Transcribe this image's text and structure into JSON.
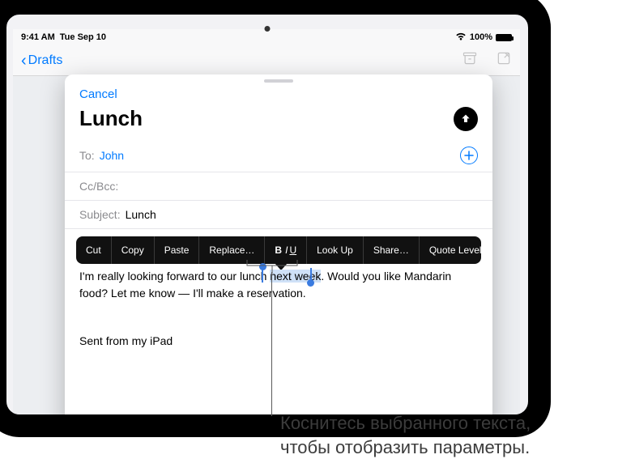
{
  "status_bar": {
    "time": "9:41 AM",
    "date": "Tue Sep 10",
    "battery_pct": "100%"
  },
  "nav": {
    "back_label": "Drafts"
  },
  "compose": {
    "cancel": "Cancel",
    "title": "Lunch",
    "to_label": "To:",
    "to_value": "John",
    "ccbcc_label": "Cc/Bcc:",
    "subject_label": "Subject:",
    "subject_value": "Lunch",
    "body_before": "I'm really looking forward to our lunch ",
    "body_selected": "next week",
    "body_after": ". Would you like Mandarin food? Let me know — I'll make a reservation.",
    "signature": "Sent from my iPad"
  },
  "context_menu": {
    "items": [
      "Cut",
      "Copy",
      "Paste",
      "Replace…",
      "B I U",
      "Look Up",
      "Share…",
      "Quote Level"
    ]
  },
  "caption": {
    "line1": "Коснитесь выбранного текста,",
    "line2": "чтобы отобразить параметры."
  }
}
